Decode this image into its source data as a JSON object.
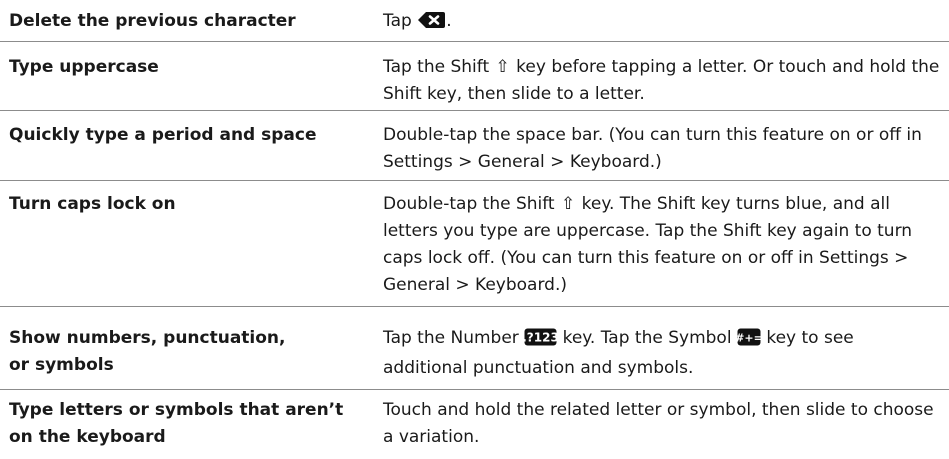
{
  "rows": [
    {
      "task": "Delete the previous character",
      "how": {
        "a": "Tap ",
        "b": "."
      }
    },
    {
      "task": "Type uppercase",
      "how": {
        "a": "Tap the Shift ",
        "b": " key before tapping a letter. Or touch and hold the Shift key, then slide to a letter."
      }
    },
    {
      "task": "Quickly type a period and space",
      "how": {
        "a": "Double-tap the space bar. (You can turn this feature on or off in Settings > General > Keyboard.)"
      }
    },
    {
      "task": "Turn caps lock on",
      "how": {
        "a": "Double-tap the Shift ",
        "b": " key. The Shift key turns blue, and all letters you type are uppercase. Tap the Shift key again to turn caps lock off. (You can turn this feature on or off in Settings > General > Keyboard.)"
      }
    },
    {
      "task_line1": "Show numbers, punctuation,",
      "task_line2": "or symbols",
      "how": {
        "a": "Tap the Number ",
        "b": " key. Tap the Symbol ",
        "c": " key to see additional punctuation and symbols."
      }
    },
    {
      "task_line1": "Type letters or symbols that aren’t",
      "task_line2": "on the keyboard",
      "how": {
        "a": "Touch and hold the related letter or symbol, then slide to choose a variation."
      }
    }
  ],
  "icons": {
    "delete": "delete-key-icon",
    "shift": "shift-key-icon",
    "number": "number-key-icon",
    "symbol": "symbol-key-icon"
  },
  "glyphs": {
    "shift": "⇧"
  },
  "colors": {
    "text": "#1a1a1a",
    "rule": "#8c8c8c",
    "key": "#111111"
  }
}
